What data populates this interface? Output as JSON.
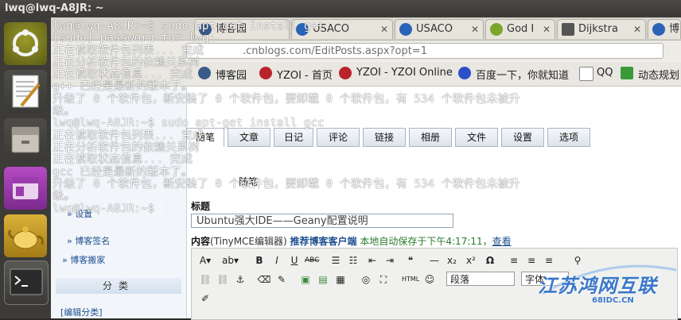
{
  "window": {
    "title": "lwq@lwq-A8JR: ~"
  },
  "launcher": {
    "items": [
      {
        "name": "dash-home-icon"
      },
      {
        "name": "text-editor-icon"
      },
      {
        "name": "file-manager-icon"
      },
      {
        "name": "purple-app-icon"
      },
      {
        "name": "teapot-app-icon"
      },
      {
        "name": "terminal-icon"
      }
    ]
  },
  "browser": {
    "tabs": [
      {
        "label": "博客园",
        "close": "✕"
      },
      {
        "label": "USACO",
        "close": "✕"
      },
      {
        "label": "USACO",
        "close": "✕"
      },
      {
        "label": "God I",
        "close": "✕"
      },
      {
        "label": "Dijkstra",
        "close": "✕"
      },
      {
        "label": "博"
      }
    ],
    "url": ".cnblogs.com/EditPosts.aspx?opt=1",
    "bookmarks": [
      {
        "label": "博客园"
      },
      {
        "label": "YZOI - 首页"
      },
      {
        "label": "YZOI - YZOI Online"
      },
      {
        "label": "百度一下，你就知道"
      },
      {
        "label": "QQ"
      },
      {
        "label": "动态规划"
      }
    ],
    "nav_tabs": [
      "随笔",
      "文章",
      "日记",
      "评论",
      "链接",
      "相册",
      "文件",
      "设置",
      "选项"
    ],
    "left_links": [
      "» 设置",
      "» 博客签名",
      "» 博客搬家"
    ],
    "left_section": "分类",
    "left_bottom_link": "[编辑分类]",
    "form": {
      "section_label": "随笔",
      "title_label": "标题",
      "title_value": "Ubuntu强大IDE——Geany配置说明",
      "content_label": "内容",
      "editor_label": "(TinyMCE编辑器)",
      "client_link": "推荐博客客户端",
      "autosave": "本地自动保存于下午4:17:11，",
      "view_link": "查看",
      "format_select": "段落",
      "font_select": "字体"
    }
  },
  "terminal": {
    "lines": [
      "lwq@lwq-A8JR:~$ sudo apt-get install g++",
      "[sudo] password for lwq:",
      "正在读取软件包列表... 完成",
      "正在分析软件包的依赖关系树",
      "正在读取状态信息... 完成",
      "g++ 已经是最新的版本了。",
      "升级了 0 个软件包，新安装了 0 个软件包，要卸载 0 个软件包，有 534 个软件包未被升",
      "级。",
      "lwq@lwq-A8JR:~$ sudo apt-get install gcc",
      "正在读取软件包列表... 完成",
      "正在分析软件包的依赖关系树",
      "正在读取状态信息... 完成",
      "gcc 已经是最新的版本了。",
      "升级了 0 个软件包，新安装了 0 个软件包，要卸载 0 个软件包，有 534 个软件包未被升",
      "级。",
      "lwq@lwq-A8JR:~$ "
    ]
  },
  "watermark": {
    "text": "江苏鸿网互联",
    "sub": "68IDC.CN"
  },
  "colors": {
    "accent": "#3a78c8",
    "terminal_text": "#ffffff",
    "launcher_bg": "#3c3b37"
  }
}
